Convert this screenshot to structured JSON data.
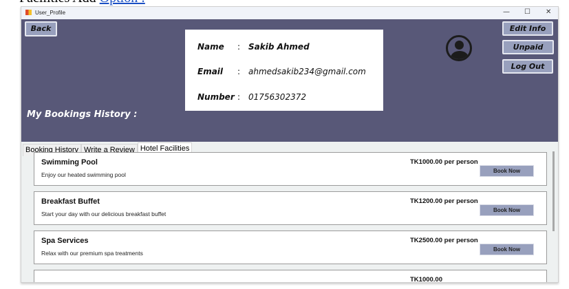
{
  "document": {
    "text": "Facilities Add ",
    "link": "Option :"
  },
  "window": {
    "title": "User_Profile",
    "minimize": "—",
    "maximize": "☐",
    "close": "✕"
  },
  "header": {
    "back": "Back",
    "edit_info": "Edit Info",
    "unpaid": "Unpaid",
    "logout": "Log Out",
    "history_title": "My Bookings History :"
  },
  "profile": {
    "name_label": "Name",
    "name": "Sakib Ahmed",
    "email_label": "Email",
    "email": "ahmedsakib234@gmail.com",
    "number_label": "Number",
    "number": "01756302372",
    "sep": ":"
  },
  "tabs": [
    {
      "label": "Booking History"
    },
    {
      "label": "Write a Review"
    },
    {
      "label": "Hotel Facilities",
      "active": true
    }
  ],
  "facilities": [
    {
      "title": "Swimming Pool",
      "description": "Enjoy our heated swimming pool",
      "price": "TK1000.00 per person",
      "button": "Book Now"
    },
    {
      "title": "Breakfast Buffet",
      "description": "Start your day with our delicious breakfast buffet",
      "price": "TK1200.00 per person",
      "button": "Book Now"
    },
    {
      "title": "Spa Services",
      "description": "Relax with our premium spa treatments",
      "price": "TK2500.00 per person",
      "button": "Book Now"
    },
    {
      "title": "",
      "description": "",
      "price": "TK1000.00",
      "button": ""
    }
  ],
  "colors": {
    "header": "#585878",
    "button": "#98a0bd"
  }
}
